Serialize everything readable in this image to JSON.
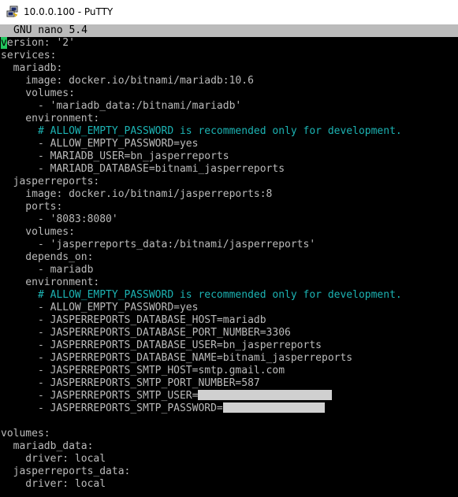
{
  "window": {
    "title": "10.0.0.100 - PuTTY"
  },
  "nano": {
    "header": "GNU nano 5.4"
  },
  "colors": {
    "comment": "#1cb3b3",
    "cursor": "#22c55e",
    "header_bg": "#bbbbbb",
    "text": "#bbbbbb"
  },
  "file": {
    "line_01_cursor": "v",
    "line_01_rest": "ersion: '2'",
    "line_02": "services:",
    "line_03": "  mariadb:",
    "line_04": "    image: docker.io/bitnami/mariadb:10.6",
    "line_05": "    volumes:",
    "line_06": "      - 'mariadb_data:/bitnami/mariadb'",
    "line_07": "    environment:",
    "line_08": "      # ALLOW_EMPTY_PASSWORD is recommended only for development.",
    "line_09": "      - ALLOW_EMPTY_PASSWORD=yes",
    "line_10": "      - MARIADB_USER=bn_jasperreports",
    "line_11": "      - MARIADB_DATABASE=bitnami_jasperreports",
    "line_12": "  jasperreports:",
    "line_13": "    image: docker.io/bitnami/jasperreports:8",
    "line_14": "    ports:",
    "line_15": "      - '8083:8080'",
    "line_16": "    volumes:",
    "line_17": "      - 'jasperreports_data:/bitnami/jasperreports'",
    "line_18": "    depends_on:",
    "line_19": "      - mariadb",
    "line_20": "    environment:",
    "line_21": "      # ALLOW_EMPTY_PASSWORD is recommended only for development.",
    "line_22": "      - ALLOW_EMPTY_PASSWORD=yes",
    "line_23": "      - JASPERREPORTS_DATABASE_HOST=mariadb",
    "line_24": "      - JASPERREPORTS_DATABASE_PORT_NUMBER=3306",
    "line_25": "      - JASPERREPORTS_DATABASE_USER=bn_jasperreports",
    "line_26": "      - JASPERREPORTS_DATABASE_NAME=bitnami_jasperreports",
    "line_27": "      - JASPERREPORTS_SMTP_HOST=smtp.gmail.com",
    "line_28": "      - JASPERREPORTS_SMTP_PORT_NUMBER=587",
    "line_29": "      - JASPERREPORTS_SMTP_USER=",
    "line_30": "      - JASPERREPORTS_SMTP_PASSWORD=",
    "line_31": "",
    "line_32": "volumes:",
    "line_33": "  mariadb_data:",
    "line_34": "    driver: local",
    "line_35": "  jasperreports_data:",
    "line_36": "    driver: local"
  }
}
